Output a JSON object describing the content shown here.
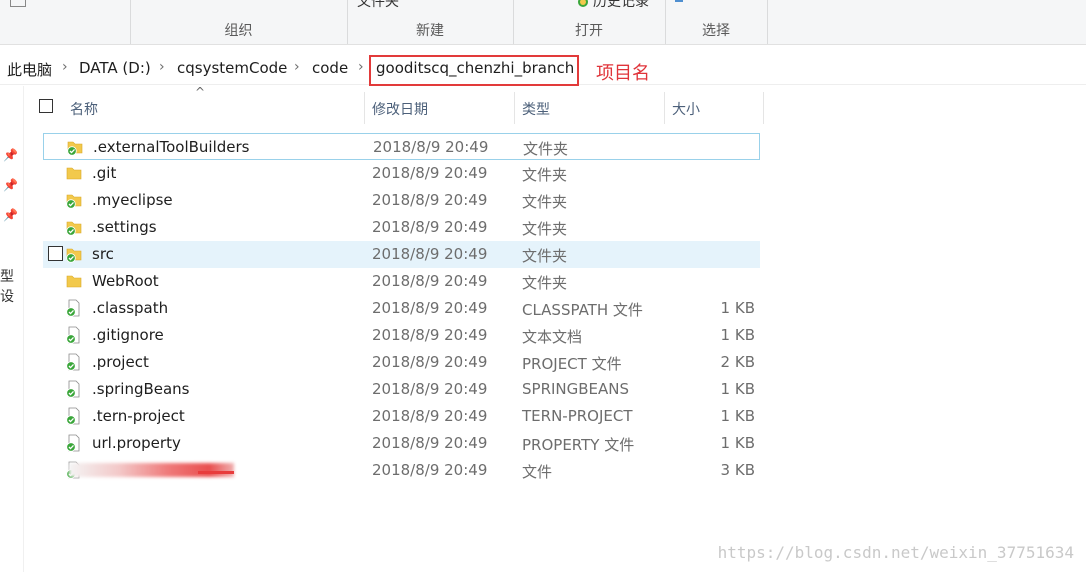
{
  "ribbon": {
    "groups": [
      {
        "label": "组织"
      },
      {
        "label": "新建",
        "cmd": "文件夹"
      },
      {
        "label": "打开",
        "cmd": "历史记录"
      },
      {
        "label": "选择"
      }
    ]
  },
  "breadcrumb": {
    "items": [
      "此电脑",
      "DATA (D:)",
      "cqsystemCode",
      "code",
      "gooditscq_chenzhi_branch"
    ],
    "separator": "›"
  },
  "annotation": "项目名",
  "nav": {
    "partial_text": "型设"
  },
  "columns": {
    "name": "名称",
    "modified": "修改日期",
    "type": "类型",
    "size": "大小"
  },
  "files": [
    {
      "name": ".externalToolBuilders",
      "modified": "2018/8/9 20:49",
      "type": "文件夹",
      "size": "",
      "icon": "folder-sync-icon"
    },
    {
      "name": ".git",
      "modified": "2018/8/9 20:49",
      "type": "文件夹",
      "size": "",
      "icon": "folder-icon"
    },
    {
      "name": ".myeclipse",
      "modified": "2018/8/9 20:49",
      "type": "文件夹",
      "size": "",
      "icon": "folder-sync-icon"
    },
    {
      "name": ".settings",
      "modified": "2018/8/9 20:49",
      "type": "文件夹",
      "size": "",
      "icon": "folder-sync-icon"
    },
    {
      "name": "src",
      "modified": "2018/8/9 20:49",
      "type": "文件夹",
      "size": "",
      "icon": "folder-sync-icon"
    },
    {
      "name": "WebRoot",
      "modified": "2018/8/9 20:49",
      "type": "文件夹",
      "size": "",
      "icon": "folder-icon"
    },
    {
      "name": ".classpath",
      "modified": "2018/8/9 20:49",
      "type": "CLASSPATH 文件",
      "size": "1 KB",
      "icon": "file-sync-icon"
    },
    {
      "name": ".gitignore",
      "modified": "2018/8/9 20:49",
      "type": "文本文档",
      "size": "1 KB",
      "icon": "file-sync-icon"
    },
    {
      "name": ".project",
      "modified": "2018/8/9 20:49",
      "type": "PROJECT 文件",
      "size": "2 KB",
      "icon": "file-sync-icon"
    },
    {
      "name": ".springBeans",
      "modified": "2018/8/9 20:49",
      "type": "SPRINGBEANS",
      "size": "1 KB",
      "icon": "file-sync-icon"
    },
    {
      "name": ".tern-project",
      "modified": "2018/8/9 20:49",
      "type": "TERN-PROJECT",
      "size": "1 KB",
      "icon": "file-sync-icon"
    },
    {
      "name": "url.property",
      "modified": "2018/8/9 20:49",
      "type": "PROPERTY 文件",
      "size": "1 KB",
      "icon": "file-sync-icon"
    },
    {
      "name": "",
      "modified": "2018/8/9 20:49",
      "type": "文件",
      "size": "3 KB",
      "icon": "file-sync-icon",
      "redacted": true
    }
  ],
  "watermark": "https://blog.csdn.net/weixin_37751634",
  "colors": {
    "highlight": "#e23a3a",
    "hover_row": "#e5f3fb",
    "focus_border": "#99d1ea",
    "sync_green": "#3aa63a",
    "folder_yellow": "#f2c94c"
  }
}
